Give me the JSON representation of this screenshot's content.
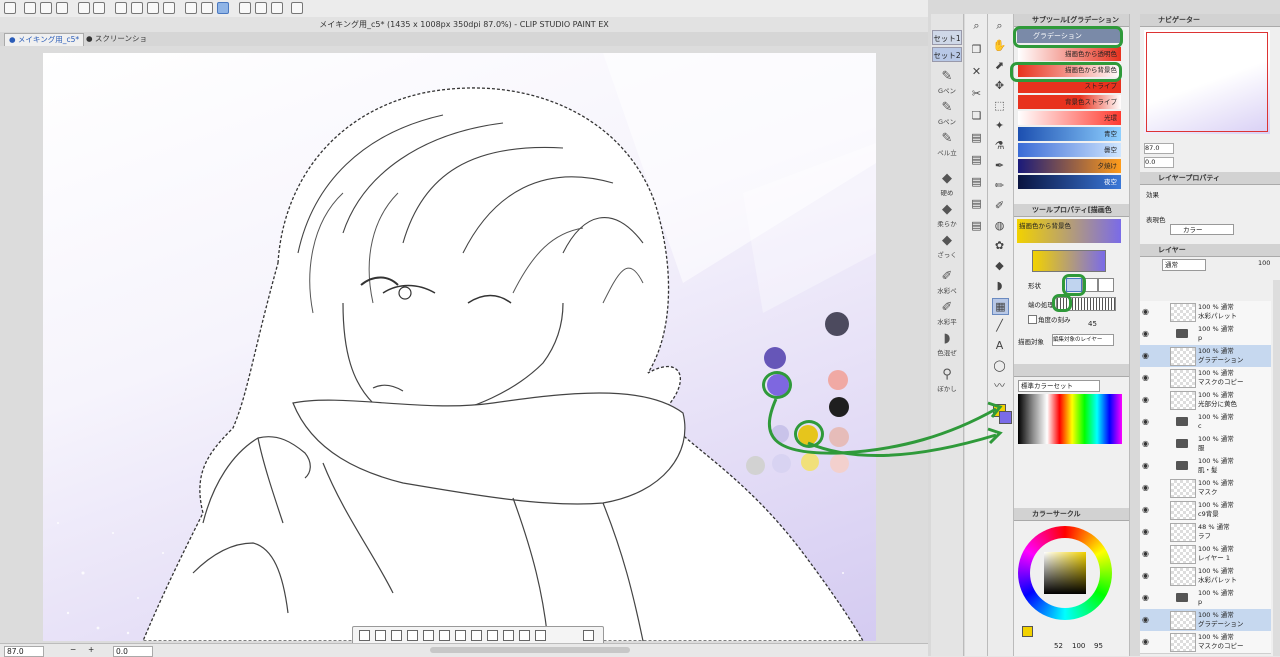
{
  "window": {
    "title": "メイキング用_c5* (1435 x 1008px 350dpi 87.0%)  - CLIP STUDIO PAINT EX"
  },
  "tabs": [
    {
      "label": "● メイキング用_c5*"
    },
    {
      "label": "● スクリーンショ"
    }
  ],
  "status": {
    "zoom": "87.0",
    "rotation": "0.0"
  },
  "sets": [
    "セット1",
    "セット2"
  ],
  "tool_column": [
    {
      "label": "Gペン"
    },
    {
      "label": "Gペン"
    },
    {
      "label": "ペル立"
    },
    {
      "label": "硬め"
    },
    {
      "label": "柔らか"
    },
    {
      "label": "ざっく"
    },
    {
      "label": "水彩ペ"
    },
    {
      "label": "水彩平"
    },
    {
      "label": "色混ぜ"
    },
    {
      "label": "ぼかし"
    }
  ],
  "subtool": {
    "header": "サブツール[グラデーション",
    "selected": "グラデーション",
    "items": [
      {
        "label": "描画色から透明色",
        "colors": [
          "#ffffff",
          "#e8321e"
        ]
      },
      {
        "label": "描画色から背景色",
        "colors": [
          "#ffffff",
          "#e8321e"
        ]
      },
      {
        "label": "ストライプ",
        "colors": [
          "#e8321e",
          "#e8321e"
        ]
      },
      {
        "label": "背景色ストライプ",
        "colors": [
          "#e8321e",
          "#ffffff"
        ]
      },
      {
        "label": "光環",
        "colors": [
          "#ffffff",
          "#ff3b30"
        ]
      },
      {
        "label": "青空",
        "colors": [
          "#1c4fb0",
          "#8fd0ff"
        ]
      },
      {
        "label": "曇空",
        "colors": [
          "#3a6bd6",
          "#cfe6ff"
        ]
      },
      {
        "label": "夕焼け",
        "colors": [
          "#1a1a7a",
          "#ff9c1a"
        ]
      },
      {
        "label": "夜空",
        "colors": [
          "#0a1440",
          "#3a78d8"
        ]
      }
    ]
  },
  "tool_property": {
    "header": "ツールプロパティ[描画色",
    "preset_name": "描画色から背景色",
    "shape_label": "形状",
    "edge_label": "端の処理",
    "angle_label": "角度の刻み",
    "angle_value": "45",
    "target_label": "描画対象",
    "target_value": "編集対象のレイヤー",
    "gradient_colors": [
      "#f2d200",
      "#7a6be8"
    ]
  },
  "color_set": {
    "header": "標準カラーセット"
  },
  "color_circle": {
    "header": "カラーサークル",
    "values": [
      "52",
      "100",
      "95"
    ]
  },
  "navigator": {
    "header": "ナビゲーター",
    "zoom": "87.0",
    "angle": "0.0"
  },
  "layer_property": {
    "header": "レイヤープロパティ",
    "effect_label": "効果",
    "expression_label": "表現色",
    "expression_value": "カラー"
  },
  "layers_panel": {
    "header": "レイヤー",
    "blend": "通常",
    "opacity": "100",
    "layers": [
      {
        "line1": "100 % 通常",
        "line2": "水彩パレット",
        "selected": false,
        "folder": false
      },
      {
        "line1": "100 % 通常",
        "line2": "p",
        "selected": false,
        "folder": true
      },
      {
        "line1": "100 % 通常",
        "line2": "グラデーション",
        "selected": true,
        "folder": false
      },
      {
        "line1": "100 % 通常",
        "line2": "マスクのコピー",
        "selected": false,
        "folder": false
      },
      {
        "line1": "100 % 通常",
        "line2": "光部分に黄色",
        "selected": false,
        "folder": false
      },
      {
        "line1": "100 % 通常",
        "line2": "c",
        "selected": false,
        "folder": true
      },
      {
        "line1": "100 % 通常",
        "line2": "服",
        "selected": false,
        "folder": true
      },
      {
        "line1": "100 % 通常",
        "line2": "肌・髪",
        "selected": false,
        "folder": true
      },
      {
        "line1": "100 % 通常",
        "line2": "マスク",
        "selected": false,
        "folder": false
      },
      {
        "line1": "100 % 通常",
        "line2": "c9背景",
        "selected": false,
        "folder": false
      },
      {
        "line1": "48 % 通常",
        "line2": "ラフ",
        "selected": false,
        "folder": false
      },
      {
        "line1": "100 % 通常",
        "line2": "レイヤー 1",
        "selected": false,
        "folder": false
      },
      {
        "line1": "100 % 通常",
        "line2": "水彩パレット",
        "selected": false,
        "folder": false
      },
      {
        "line1": "100 % 通常",
        "line2": "p",
        "selected": false,
        "folder": true
      },
      {
        "line1": "100 % 通常",
        "line2": "グラデーション",
        "selected": true,
        "folder": false
      },
      {
        "line1": "100 % 通常",
        "line2": "マスクのコピー",
        "selected": false,
        "folder": false
      }
    ]
  },
  "colors": {
    "annotation_green": "#2f9a3a",
    "main_color": "#f2d200",
    "sub_color": "#7a6be8",
    "selection": "#c6d8ef"
  },
  "palette_dots": [
    {
      "color": "#4c4a5e"
    },
    {
      "color": "#6656b8"
    },
    {
      "color": "#7e67e0"
    },
    {
      "color": "#f0a9a4"
    },
    {
      "color": "#1f1f1f"
    },
    {
      "color": "#e6c51c"
    },
    {
      "color": "#c9c3ea"
    },
    {
      "color": "#e6bcb9"
    },
    {
      "color": "#f1e07a"
    },
    {
      "color": "#d2d2d2"
    },
    {
      "color": "#d8d3f2"
    },
    {
      "color": "#f3d0cd"
    }
  ]
}
